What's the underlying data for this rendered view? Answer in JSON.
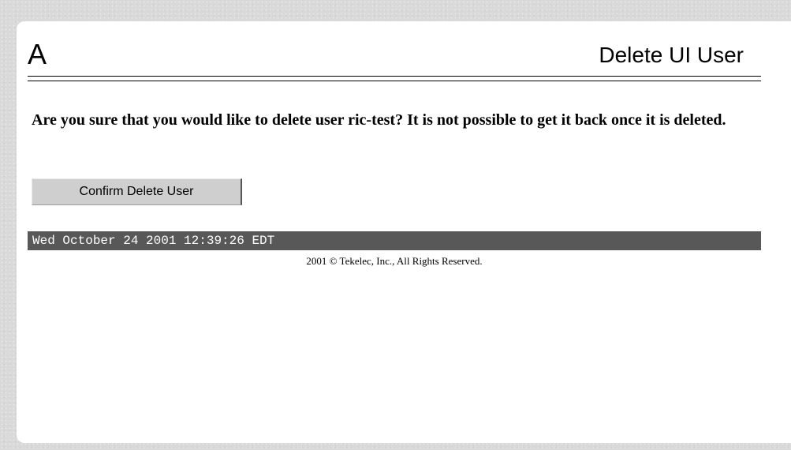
{
  "header": {
    "letter": "A",
    "title": "Delete UI User"
  },
  "dialog": {
    "question": "Are you sure that you would like to delete user ric-test? It is not possible to get it back once it is deleted.",
    "confirm_label": "Confirm Delete User"
  },
  "status": {
    "timestamp": "Wed October 24 2001 12:39:26 EDT"
  },
  "footer": {
    "copyright": "2001 © Tekelec, Inc., All Rights Reserved."
  },
  "colors": {
    "page_background": "#d9d9d9",
    "panel_background": "#ffffff",
    "timestamp_bar": "#585858",
    "button_face": "#cfcfcf"
  }
}
